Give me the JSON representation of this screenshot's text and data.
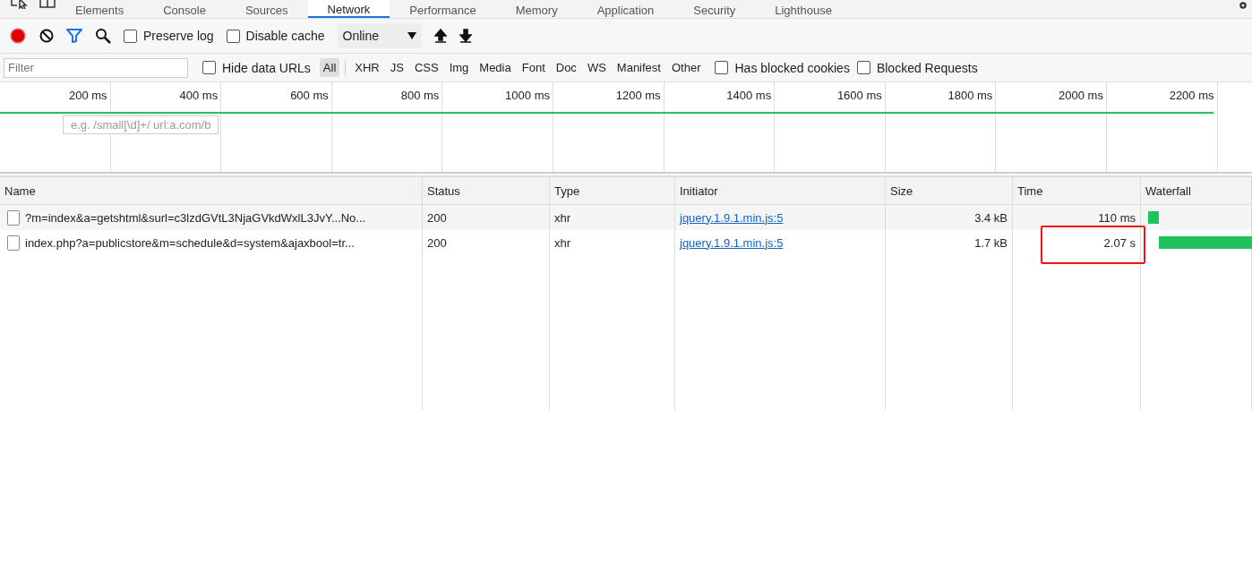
{
  "tabs": [
    {
      "label": "Elements",
      "selected": false
    },
    {
      "label": "Console",
      "selected": false
    },
    {
      "label": "Sources",
      "selected": false
    },
    {
      "label": "Network",
      "selected": true
    },
    {
      "label": "Performance",
      "selected": false
    },
    {
      "label": "Memory",
      "selected": false
    },
    {
      "label": "Application",
      "selected": false
    },
    {
      "label": "Security",
      "selected": false
    },
    {
      "label": "Lighthouse",
      "selected": false
    }
  ],
  "toolbar": {
    "recording": true,
    "filter_active": true,
    "preserve_log": {
      "label": "Preserve log",
      "checked": false
    },
    "disable_cache": {
      "label": "Disable cache",
      "checked": false
    },
    "throttling": "Online"
  },
  "filter_bar": {
    "placeholder": "Filter",
    "hide_data_urls": {
      "label": "Hide data URLs",
      "checked": false
    },
    "types": [
      {
        "label": "All",
        "selected": true
      },
      {
        "label": "XHR",
        "selected": false
      },
      {
        "label": "JS",
        "selected": false
      },
      {
        "label": "CSS",
        "selected": false
      },
      {
        "label": "Img",
        "selected": false
      },
      {
        "label": "Media",
        "selected": false
      },
      {
        "label": "Font",
        "selected": false
      },
      {
        "label": "Doc",
        "selected": false
      },
      {
        "label": "WS",
        "selected": false
      },
      {
        "label": "Manifest",
        "selected": false
      },
      {
        "label": "Other",
        "selected": false
      }
    ],
    "has_blocked_cookies": {
      "label": "Has blocked cookies",
      "checked": false
    },
    "blocked_requests": {
      "label": "Blocked Requests",
      "checked": false
    }
  },
  "overview": {
    "ticks": [
      "200 ms",
      "400 ms",
      "600 ms",
      "800 ms",
      "1000 ms",
      "1200 ms",
      "1400 ms",
      "1600 ms",
      "1800 ms",
      "2000 ms",
      "2200 ms"
    ],
    "tooltip": "e.g. /small[\\d]+/ url:a.com/b"
  },
  "table": {
    "columns": [
      "Name",
      "Status",
      "Type",
      "Initiator",
      "Size",
      "Time",
      "Waterfall"
    ],
    "rows": [
      {
        "name": "?m=index&a=getshtml&surl=c3lzdGVtL3NjaGVkdWxlL3JvY...No...",
        "status": "200",
        "type": "xhr",
        "initiator": "jquery.1.9.1.min.js:5",
        "size": "3.4 kB",
        "time": "110 ms",
        "highlighted": false
      },
      {
        "name": "index.php?a=publicstore&m=schedule&d=system&ajaxbool=tr...",
        "status": "200",
        "type": "xhr",
        "initiator": "jquery.1.9.1.min.js:5",
        "size": "1.7 kB",
        "time": "2.07 s",
        "highlighted": true
      }
    ]
  }
}
